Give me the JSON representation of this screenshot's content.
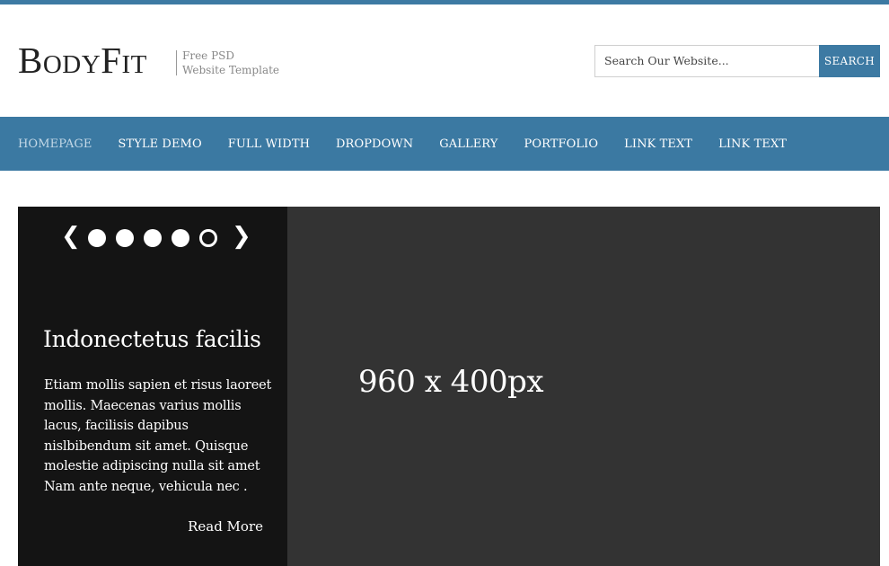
{
  "header": {
    "logo": {
      "first": "B",
      "first_rest": "ody",
      "second": "F",
      "second_rest": "it"
    },
    "tagline": [
      "Free PSD",
      "Website Template"
    ],
    "search": {
      "placeholder": "Search Our Website...",
      "button_label": "SEARCH"
    }
  },
  "nav": {
    "items": [
      {
        "label": "HOMEPAGE",
        "active": true
      },
      {
        "label": "STYLE DEMO"
      },
      {
        "label": "FULL WIDTH"
      },
      {
        "label": "DROPDOWN"
      },
      {
        "label": "GALLERY"
      },
      {
        "label": "PORTFOLIO"
      },
      {
        "label": "LINK TEXT"
      },
      {
        "label": "LINK TEXT"
      }
    ]
  },
  "slider": {
    "prev_icon": "chevron-left-icon",
    "next_icon": "chevron-right-icon",
    "pager_dots": 5,
    "active_dot": 5,
    "title": "Indonectetus facilis",
    "body_lines": [
      "Etiam mollis sapien et risus laoreet",
      "mollis. Maecenas varius mollis",
      "lacus, facilisis dapibus",
      "nislbibendum sit amet. Quisque",
      "molestie adipiscing nulla sit amet",
      "Nam ante neque, vehicula nec ."
    ],
    "read_more": "Read More",
    "image_label": "960 x 400px"
  },
  "colors": {
    "accent": "#3b79a2",
    "panel": "#141414",
    "image_bg": "#333333"
  }
}
